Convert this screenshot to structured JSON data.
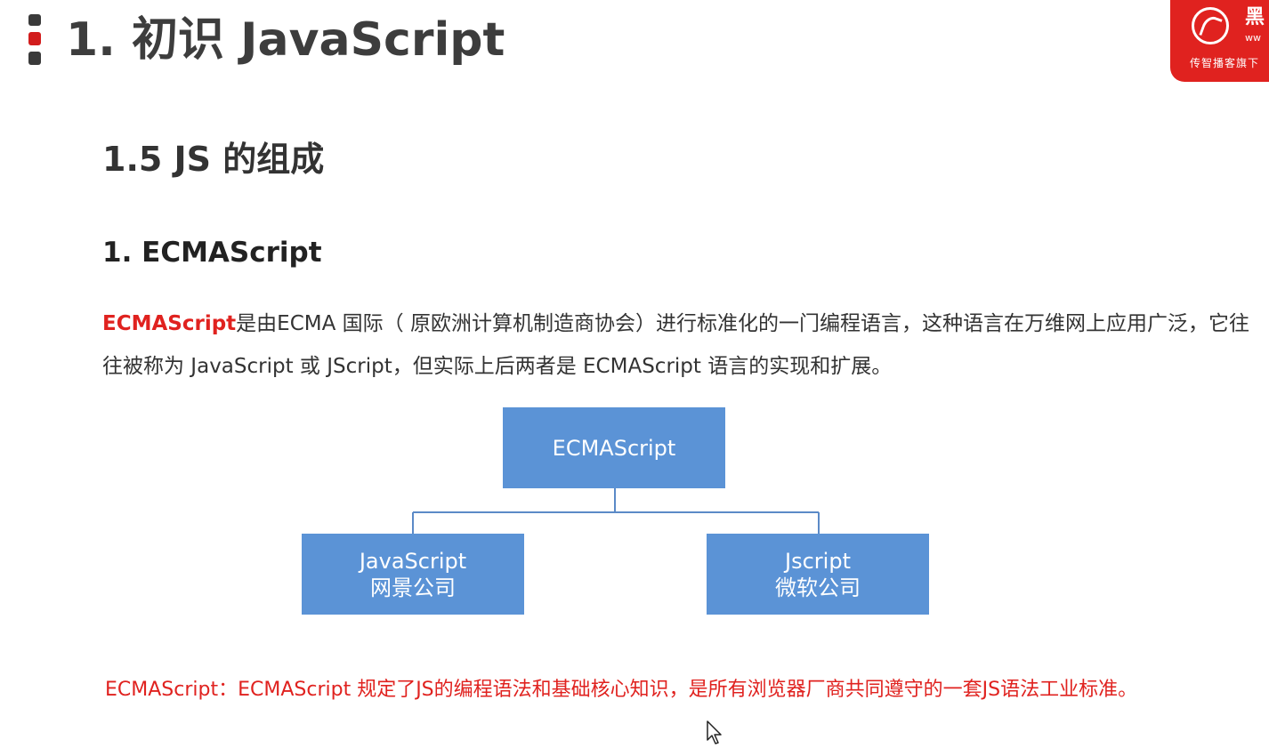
{
  "header": {
    "title": "1. 初识 JavaScript"
  },
  "logo": {
    "mark": "黑",
    "sub": "ww",
    "caption": "传智播客旗下"
  },
  "section": {
    "title": "1.5 JS 的组成"
  },
  "subsection": {
    "title": "1. ECMAScript"
  },
  "paragraph": {
    "highlight": "ECMAScript",
    "text": "是由ECMA 国际（ 原欧洲计算机制造商协会）进行标准化的一门编程语言，这种语言在万维网上应用广泛，它往往被称为 JavaScript 或 JScript，但实际上后两者是 ECMAScript 语言的实现和扩展。"
  },
  "diagram": {
    "root": "ECMAScript",
    "left": {
      "line1": "JavaScript",
      "line2": "网景公司"
    },
    "right": {
      "line1": "Jscript",
      "line2": "微软公司"
    }
  },
  "note": {
    "text": "ECMAScript：ECMAScript 规定了JS的编程语法和基础核心知识，是所有浏览器厂商共同遵守的一套JS语法工业标准。"
  },
  "colors": {
    "accent": "#e0221f",
    "box": "#5b93d6",
    "connector": "#5b8ac7"
  }
}
